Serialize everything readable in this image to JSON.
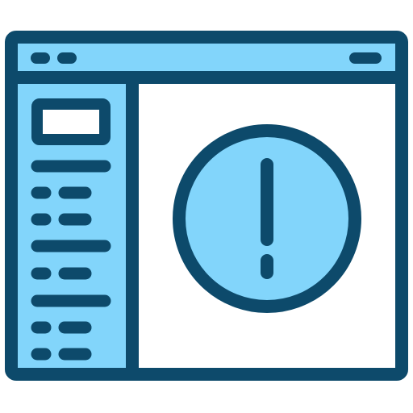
{
  "icon": {
    "name": "browser-window-alert-icon",
    "glyph": "!"
  },
  "colors": {
    "outline": "#0d4a6b",
    "accent_fill": "#82d5fb",
    "content_fill": "#ffffff",
    "background": "#ffffff"
  },
  "window": {
    "title_bar": {
      "controls_left": [
        "dot-control",
        "dot-control"
      ],
      "control_right": "pill-control"
    },
    "sidebar": {
      "items": [
        "search-box",
        "long-line",
        "short-pair",
        "short-pair",
        "long-line",
        "short-pair",
        "long-line",
        "short-pair",
        "short-pair"
      ]
    },
    "main": {
      "alert_symbol": "exclamation-icon"
    }
  }
}
